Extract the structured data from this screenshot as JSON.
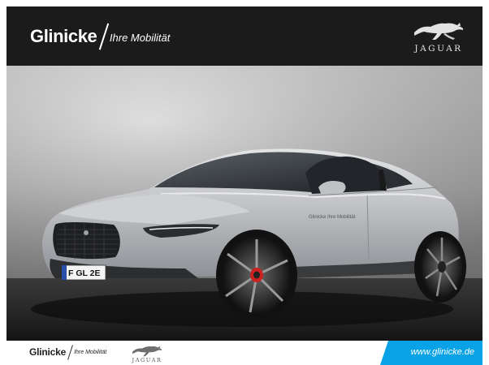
{
  "header": {
    "brand_name": "Glinicke",
    "brand_tagline": "Ihre Mobilität",
    "logo_wordmark": "JAGUAR",
    "icons": {
      "brand_logo": "glinicke-logo",
      "make_logo": "jaguar-leaper-icon"
    },
    "background_color": "#1b1b1b"
  },
  "photo": {
    "subject": "car-photo",
    "license_plate": "F GL 2E",
    "door_decal": "Glinicke Ihre Mobilität",
    "car_color": "#bdbfc2"
  },
  "footer": {
    "brand_name": "Glinicke",
    "brand_tagline": "Ihre Mobilität",
    "logo_wordmark": "JAGUAR",
    "url": "www.glinicke.de",
    "accent_color": "#0aa2e6"
  }
}
